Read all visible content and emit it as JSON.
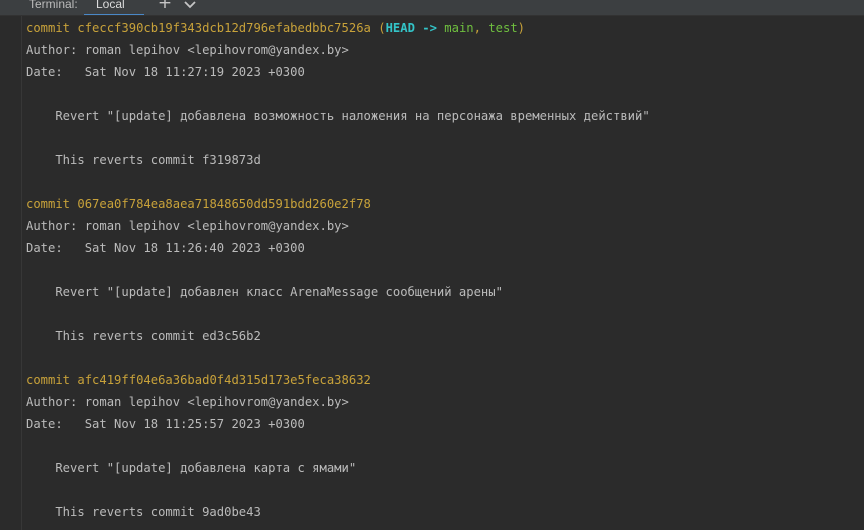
{
  "tabbar": {
    "title": "Terminal:",
    "tab_label": "Local",
    "add_symbol": "+"
  },
  "colors": {
    "background": "#2b2b2b",
    "text": "#bbbbbb",
    "commit": "#c8a23a",
    "head": "#33c4c8",
    "branch": "#6fbf3f",
    "tab_underline": "#4a88c7"
  },
  "icons": {
    "add": "plus-icon",
    "dropdown": "chevron-down-icon"
  },
  "commits": [
    {
      "prefix": "commit ",
      "hash": "cfeccf390cb19f343dcb12d796efabedbbc7526a",
      "refs_open": " (",
      "head": "HEAD -> ",
      "branch1": "main",
      "sep": ", ",
      "branch2": "test",
      "refs_close": ")",
      "author": "Author: roman lepihov <lepihovrom@yandex.by>",
      "date": "Date:   Sat Nov 18 11:27:19 2023 +0300",
      "message": "    Revert \"[update] добавлена возможность наложения на персонажа временных действий\"",
      "reverts": "    This reverts commit f319873d"
    },
    {
      "prefix": "commit ",
      "hash": "067ea0f784ea8aea71848650dd591bdd260e2f78",
      "author": "Author: roman lepihov <lepihovrom@yandex.by>",
      "date": "Date:   Sat Nov 18 11:26:40 2023 +0300",
      "message": "    Revert \"[update] добавлен класс ArenaMessage сообщений арены\"",
      "reverts": "    This reverts commit ed3c56b2"
    },
    {
      "prefix": "commit ",
      "hash": "afc419ff04e6a36bad0f4d315d173e5feca38632",
      "author": "Author: roman lepihov <lepihovrom@yandex.by>",
      "date": "Date:   Sat Nov 18 11:25:57 2023 +0300",
      "message": "    Revert \"[update] добавлена карта с ямами\"",
      "reverts": "    This reverts commit 9ad0be43"
    }
  ]
}
